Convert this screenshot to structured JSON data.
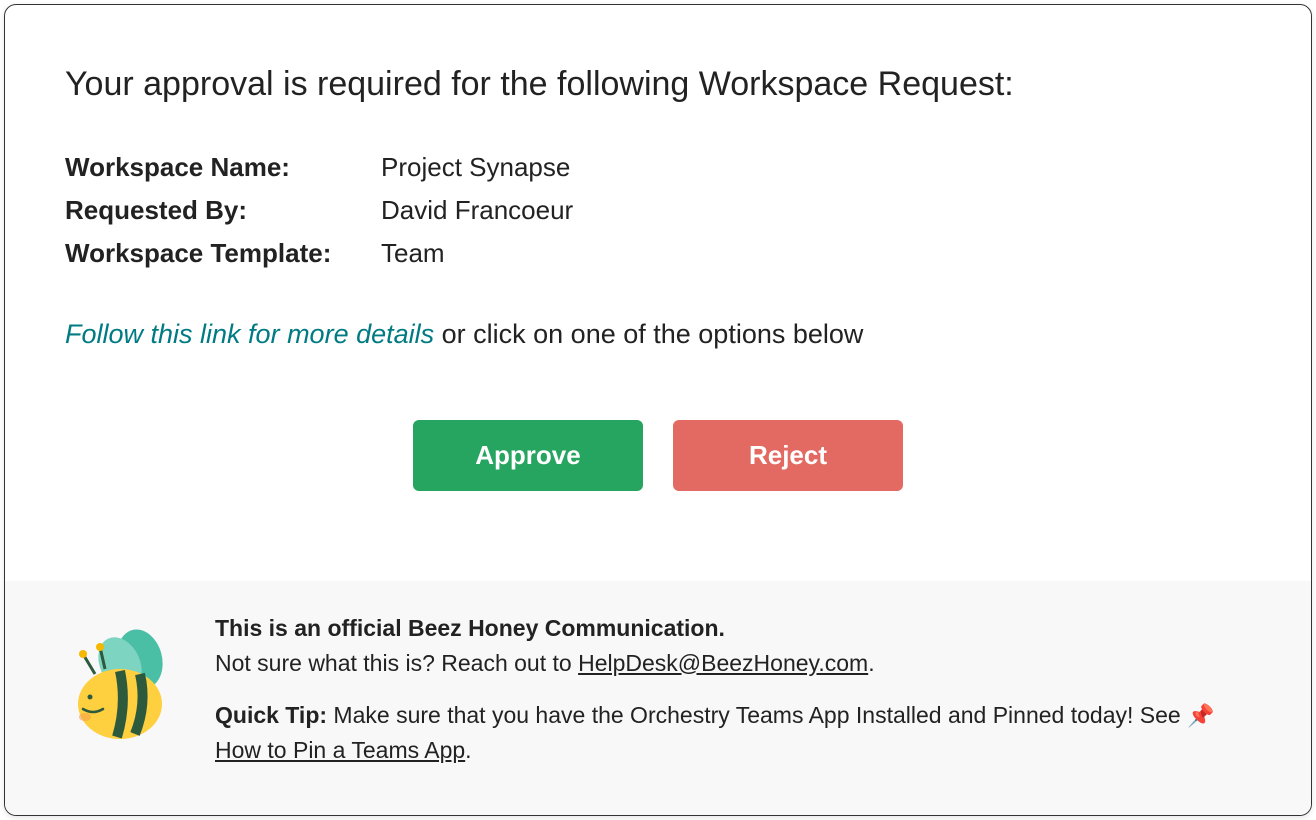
{
  "heading": "Your approval is required for the following Workspace Request:",
  "details": {
    "workspace_name_label": "Workspace Name:",
    "workspace_name_value": "Project Synapse",
    "requested_by_label": "Requested By:",
    "requested_by_value": "David Francoeur",
    "workspace_template_label": "Workspace Template:",
    "workspace_template_value": "Team"
  },
  "link": {
    "text": "Follow this link for more details",
    "suffix": " or click on one of the options below"
  },
  "buttons": {
    "approve": "Approve",
    "reject": "Reject"
  },
  "footer": {
    "line1_bold": "This is an official Beez Honey Communication.",
    "line2_prefix": "Not sure what this is? Reach out to ",
    "line2_link": "HelpDesk@BeezHoney.com",
    "line2_suffix": ".",
    "line3_bold": "Quick Tip:",
    "line3_text": " Make sure that you have the Orchestry Teams App Installed and Pinned today! See ",
    "line3_emoji": "📌",
    "line3_link": "How to Pin a Teams App",
    "line3_suffix": "."
  }
}
